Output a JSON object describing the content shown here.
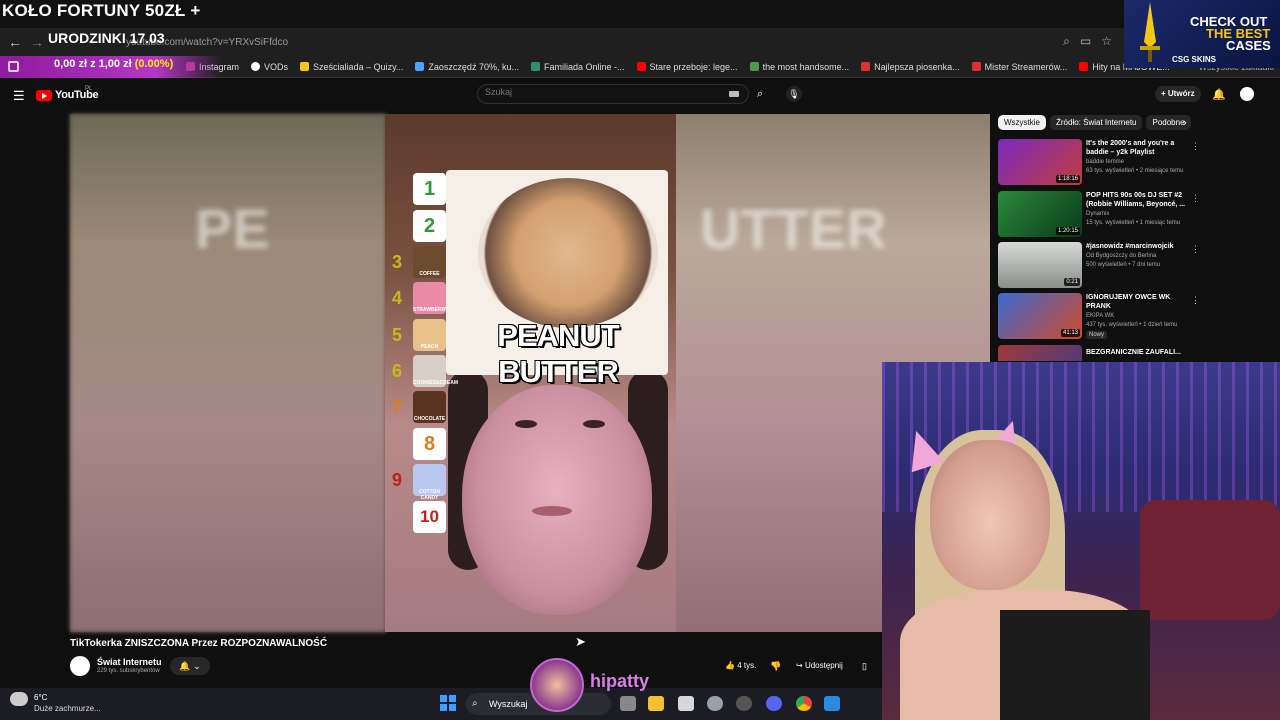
{
  "overlay": {
    "title": "KOŁO FORTUNY 50ZŁ +",
    "birthday": "URODZINKI 17.03",
    "donation_prefix": "0,00 zł z 1,00 zł ",
    "donation_pct": "(0.00%)"
  },
  "browser": {
    "url": "youtube.com/watch?v=YRXvSiFfdco",
    "bookmarks": [
      {
        "label": "Instagram",
        "color": "#c13584"
      },
      {
        "label": "VODs",
        "color": "#ffffff"
      },
      {
        "label": "Sześcialiada – Quizy...",
        "color": "#f5c518"
      },
      {
        "label": "Zaoszczędź 70%, ku...",
        "color": "#4aa3ff"
      },
      {
        "label": "Familiada Online -...",
        "color": "#2f8f6a"
      },
      {
        "label": "Stare przeboje: lege...",
        "color": "#ff0000"
      },
      {
        "label": "the most handsome...",
        "color": "#4a9b4a"
      },
      {
        "label": "Najlepsza piosenka...",
        "color": "#e03030"
      },
      {
        "label": "Mister Streamerów...",
        "color": "#e03030"
      },
      {
        "label": "Hity na MAJÓWE...",
        "color": "#ff0000"
      }
    ],
    "bookmarks_right": "Wszystkie zakładki"
  },
  "ad": {
    "line1": "CHECK OUT",
    "line2": "THE BEST",
    "line3": "CASES",
    "brand": "CSG SKINS"
  },
  "youtube": {
    "logo": "YouTube",
    "region": "PL",
    "search_placeholder": "Szukaj",
    "create_label": "Utwórz",
    "video_title": "TikTokerka ZNISZCZONA Przez ROZPOZNAWALNOŚĆ",
    "channel_name": "Świat Internetu",
    "channel_subs": "229 tys. subskrybentów",
    "likes": "4 tys.",
    "share_label": "Udostępnij"
  },
  "video": {
    "blur_left_text": "PE",
    "blur_right_text": "UTTER",
    "caption": "PEANUT BUTTER",
    "ranks": [
      "1",
      "2",
      "3",
      "4",
      "5",
      "6",
      "7",
      "8",
      "9",
      "10"
    ],
    "flavors": [
      "COFFEE",
      "STRAWBERRY",
      "PEACH",
      "COOKIES&CREAM",
      "CHOCOLATE",
      "COTTON CANDY"
    ]
  },
  "sidebar": {
    "chips": [
      "Wszystkie",
      "Źródło: Świat Internetu",
      "Podobne"
    ],
    "recommendations": [
      {
        "title": "It's the 2000's and you're a baddie – y2k Playlist",
        "channel": "baddie femme",
        "meta": "63 tys. wyświetleń • 2 miesiące temu",
        "duration": "1:18:16",
        "color": "#c03c3c"
      },
      {
        "title": "POP HITS 90s 00s DJ SET #2 (Robbie Williams, Beyoncé, ...",
        "channel": "Dynamix",
        "meta": "15 tys. wyświetleń • 1 miesiąc temu",
        "duration": "1:20:15",
        "color": "#2a8a3a"
      },
      {
        "title": "#jasnowidz #marcinwojcik",
        "channel": "Od Bydgoszczy do Berlina",
        "meta": "500 wyświetleń • 7 dni temu",
        "duration": "0:21",
        "color": "#8a8f8a"
      },
      {
        "title": "IGNORUJEMY OWCE WK PRANK",
        "channel": "EKIPA WK",
        "meta": "437 tys. wyświetleń • 1 dzień temu",
        "duration": "41:13",
        "badge": "Nowy",
        "color": "#3a6ad0"
      },
      {
        "title": "BEZGRANICZNIE ZAUFALI...",
        "channel": "",
        "meta": "",
        "duration": "",
        "color": "#a03a3a"
      }
    ]
  },
  "streamer": {
    "name": "hipatty"
  },
  "taskbar": {
    "temperature": "6°C",
    "weather": "Duże zachmurze...",
    "search_label": "Wyszukaj"
  }
}
